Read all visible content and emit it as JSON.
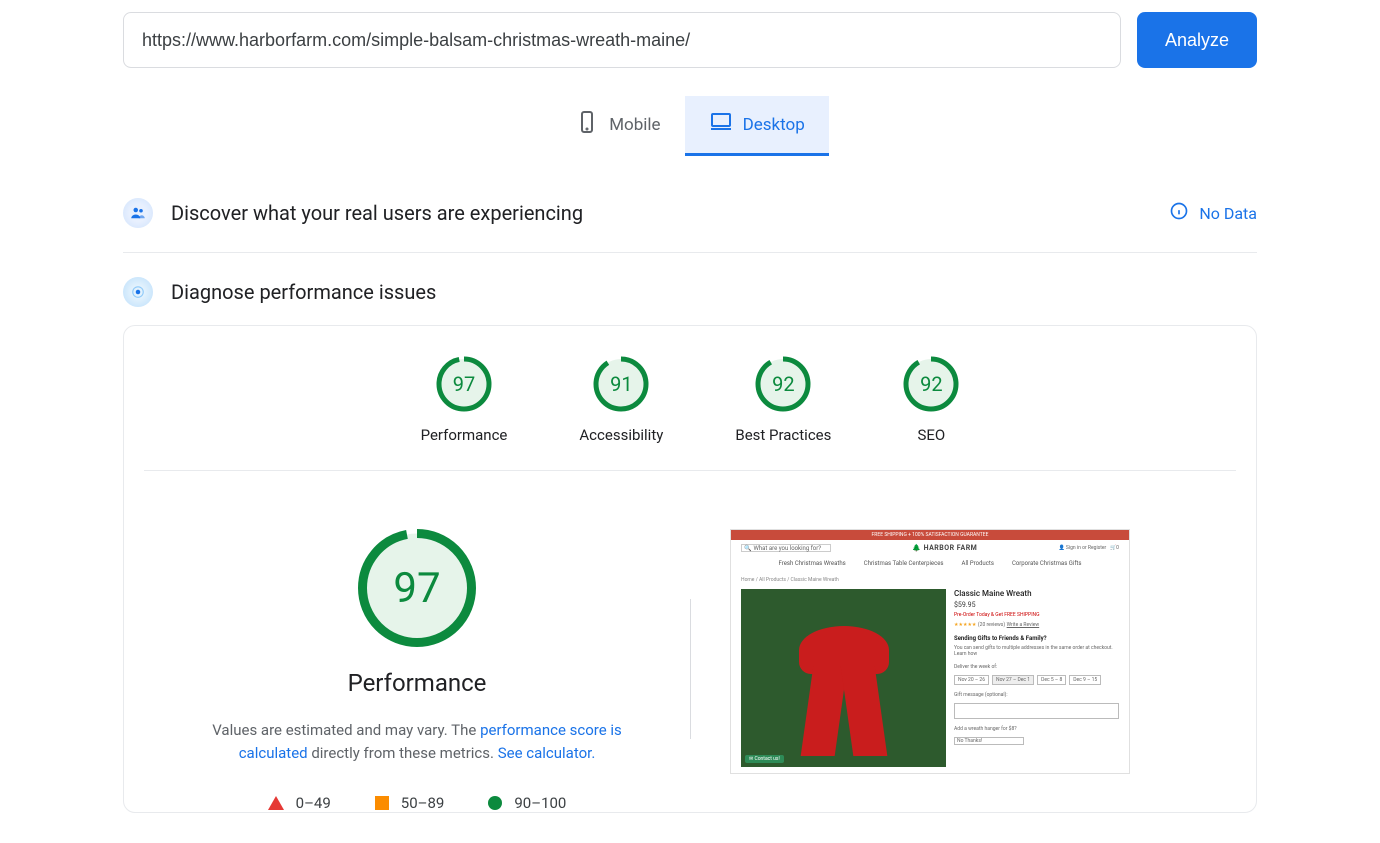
{
  "url_value": "https://www.harborfarm.com/simple-balsam-christmas-wreath-maine/",
  "analyze_label": "Analyze",
  "tabs": {
    "mobile": "Mobile",
    "desktop": "Desktop"
  },
  "discover_title": "Discover what your real users are experiencing",
  "no_data_label": "No Data",
  "diagnose_title": "Diagnose performance issues",
  "gauges": [
    {
      "score": "97",
      "label": "Performance",
      "dash": "152 157"
    },
    {
      "score": "91",
      "label": "Accessibility",
      "dash": "143 157"
    },
    {
      "score": "92",
      "label": "Best Practices",
      "dash": "144 157"
    },
    {
      "score": "92",
      "label": "SEO",
      "dash": "144 157"
    }
  ],
  "big": {
    "score": "97",
    "label": "Performance",
    "dash": "332 342"
  },
  "desc": {
    "t1": "Values are estimated and may vary. The ",
    "link1": "performance score is calculated",
    "t2": " directly from these metrics. ",
    "link2": "See calculator."
  },
  "legend": {
    "r": "0–49",
    "o": "50–89",
    "g": "90–100"
  },
  "thumb": {
    "banner": "FREE SHIPPING + 100% SATISFACTION GUARANTEE",
    "search_ph": "What are you looking for?",
    "logo": "HARBOR FARM",
    "acct": "Sign in or Register",
    "nav1": "Fresh Christmas Wreaths",
    "nav2": "Christmas Table Centerpieces",
    "nav3": "All Products",
    "nav4": "Corporate Christmas Gifts",
    "bc": "Home / All Products / Classic Maine Wreath",
    "pname": "Classic Maine Wreath",
    "price": "$59.95",
    "preorder": "Pre-Order Today & Get FREE SHIPPING",
    "reviews": "(20 reviews)",
    "writerev": "Write a Review",
    "gift_h": "Sending Gifts to Friends & Family?",
    "gift_t": "You can send gifts to multiple addresses in the same order at checkout. Learn how",
    "deliver": "Deliver the week of:",
    "d1": "Nov 20 – 26",
    "d2": "Nov 27 – Dec 1",
    "d3": "Dec 5 – 8",
    "d4": "Dec 9 – 15",
    "gmsg": "Gift message (optional):",
    "hanger": "Add a wreath hanger for $8?",
    "hanger_opt": "No Thanks!",
    "chat": "Contact us!"
  }
}
